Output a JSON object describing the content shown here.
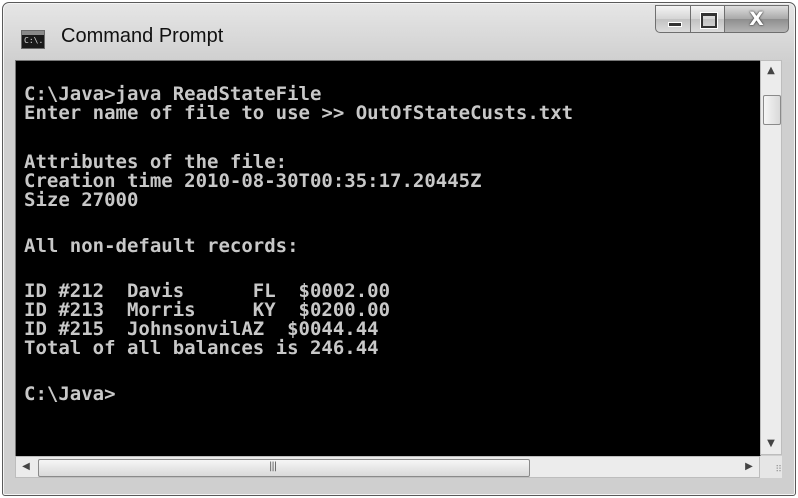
{
  "window": {
    "title": "Command Prompt",
    "icon_text": "C:\\.",
    "controls": {
      "minimize": "minimize-icon",
      "maximize": "maximize-icon",
      "close_glyph": "X"
    }
  },
  "console": {
    "lines": [
      "C:\\Java>java ReadStateFile",
      "Enter name of file to use >> OutOfStateCusts.txt",
      "",
      "Attributes of the file:",
      "Creation time 2010-08-30T00:35:17.20445Z",
      "Size 27000",
      "",
      "All non-default records:",
      "",
      "ID #212  Davis      FL  $0002.00",
      "ID #213  Morris     KY  $0200.00",
      "ID #215  JohnsonvilAZ  $0044.44",
      "Total of all balances is 246.44",
      "",
      "C:\\Java>"
    ]
  },
  "scrollbars": {
    "horizontal_grip": "|||",
    "up_arrow": "▲",
    "down_arrow": "▼",
    "left_arrow": "◀",
    "right_arrow": "▶",
    "resize_grip": "⠿"
  },
  "colors": {
    "console_bg": "#000000",
    "console_text": "#c0c0c0",
    "close_button": "#9a9a9a"
  }
}
